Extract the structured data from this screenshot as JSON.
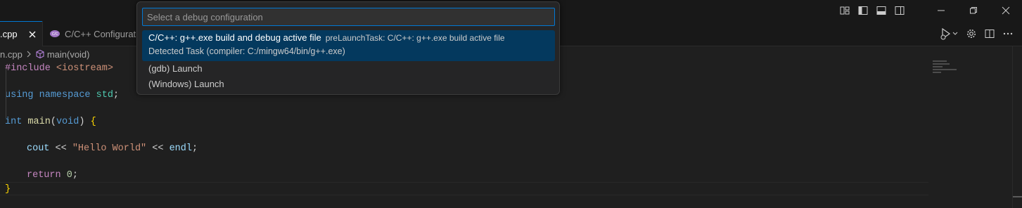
{
  "tabs": {
    "active": {
      "label": ".cpp",
      "close_glyph": "✕"
    },
    "inactive": {
      "label": "C/C++ Configurati",
      "icon": "cpp-config-icon"
    }
  },
  "breadcrumb": {
    "file": "n.cpp",
    "symbol": "main(void)",
    "symbol_icon": "method-cube-icon"
  },
  "quick_pick": {
    "placeholder": "Select a debug configuration",
    "items": [
      {
        "label": "C/C++: g++.exe build and debug active file",
        "description": "preLaunchTask: C/C++: g++.exe build active file",
        "detail": "Detected Task (compiler: C:/mingw64/bin/g++.exe)",
        "selected": true
      },
      {
        "label": "(gdb) Launch"
      },
      {
        "label": "(Windows) Launch"
      }
    ]
  },
  "code": {
    "line1": {
      "directive": "#include",
      "header": "<iostream>"
    },
    "line3": {
      "kw1": "using",
      "kw2": "namespace",
      "ns": "std",
      "end": ";"
    },
    "line5": {
      "type": "int",
      "fn": "main",
      "open": "(",
      "param": "void",
      "close": ")",
      "brace": "{"
    },
    "line7": {
      "ident": "cout",
      "op1": "<<",
      "str": "\"Hello World\"",
      "op2": "<<",
      "endl": "endl",
      "end": ";"
    },
    "line9": {
      "kw": "return",
      "num": "0",
      "end": ";"
    },
    "line10": {
      "brace": "}"
    }
  },
  "colors": {
    "accent": "#0078d4",
    "selection": "#04395e",
    "background": "#1f1f1f"
  }
}
